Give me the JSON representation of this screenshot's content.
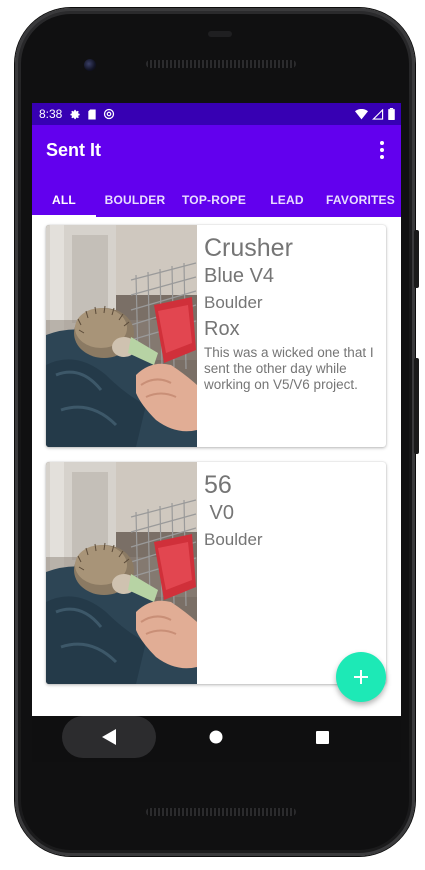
{
  "status_bar": {
    "time": "8:38",
    "left_icons": [
      "settings-icon",
      "sd-card-icon",
      "at-sign-icon"
    ],
    "right_icons": [
      "wifi-icon",
      "cell-signal-icon",
      "battery-icon"
    ]
  },
  "app_bar": {
    "title": "Sent It",
    "overflow_icon": "more-vert-icon",
    "tabs": [
      {
        "label": "ALL",
        "active": true
      },
      {
        "label": "BOULDER",
        "active": false
      },
      {
        "label": "TOP-ROPE",
        "active": false
      },
      {
        "label": "LEAD",
        "active": false
      },
      {
        "label": "FAVORITES",
        "active": false
      }
    ]
  },
  "climbs": [
    {
      "name": "Crusher",
      "grade": "Blue V4",
      "type": "Boulder",
      "setter": "Rox",
      "description": "This was a wicked one that I sent the other day while working on V5/V6 project."
    },
    {
      "name": "56",
      "grade": " V0",
      "type": "Boulder"
    }
  ],
  "fab": {
    "icon": "add-icon",
    "label": "+"
  },
  "nav_bar": {
    "buttons": [
      "back-icon",
      "home-icon",
      "recents-icon"
    ]
  },
  "colors": {
    "status_bar": "#3700b3",
    "primary": "#6200ee",
    "accent": "#1de9b6",
    "text_secondary": "#757575"
  }
}
